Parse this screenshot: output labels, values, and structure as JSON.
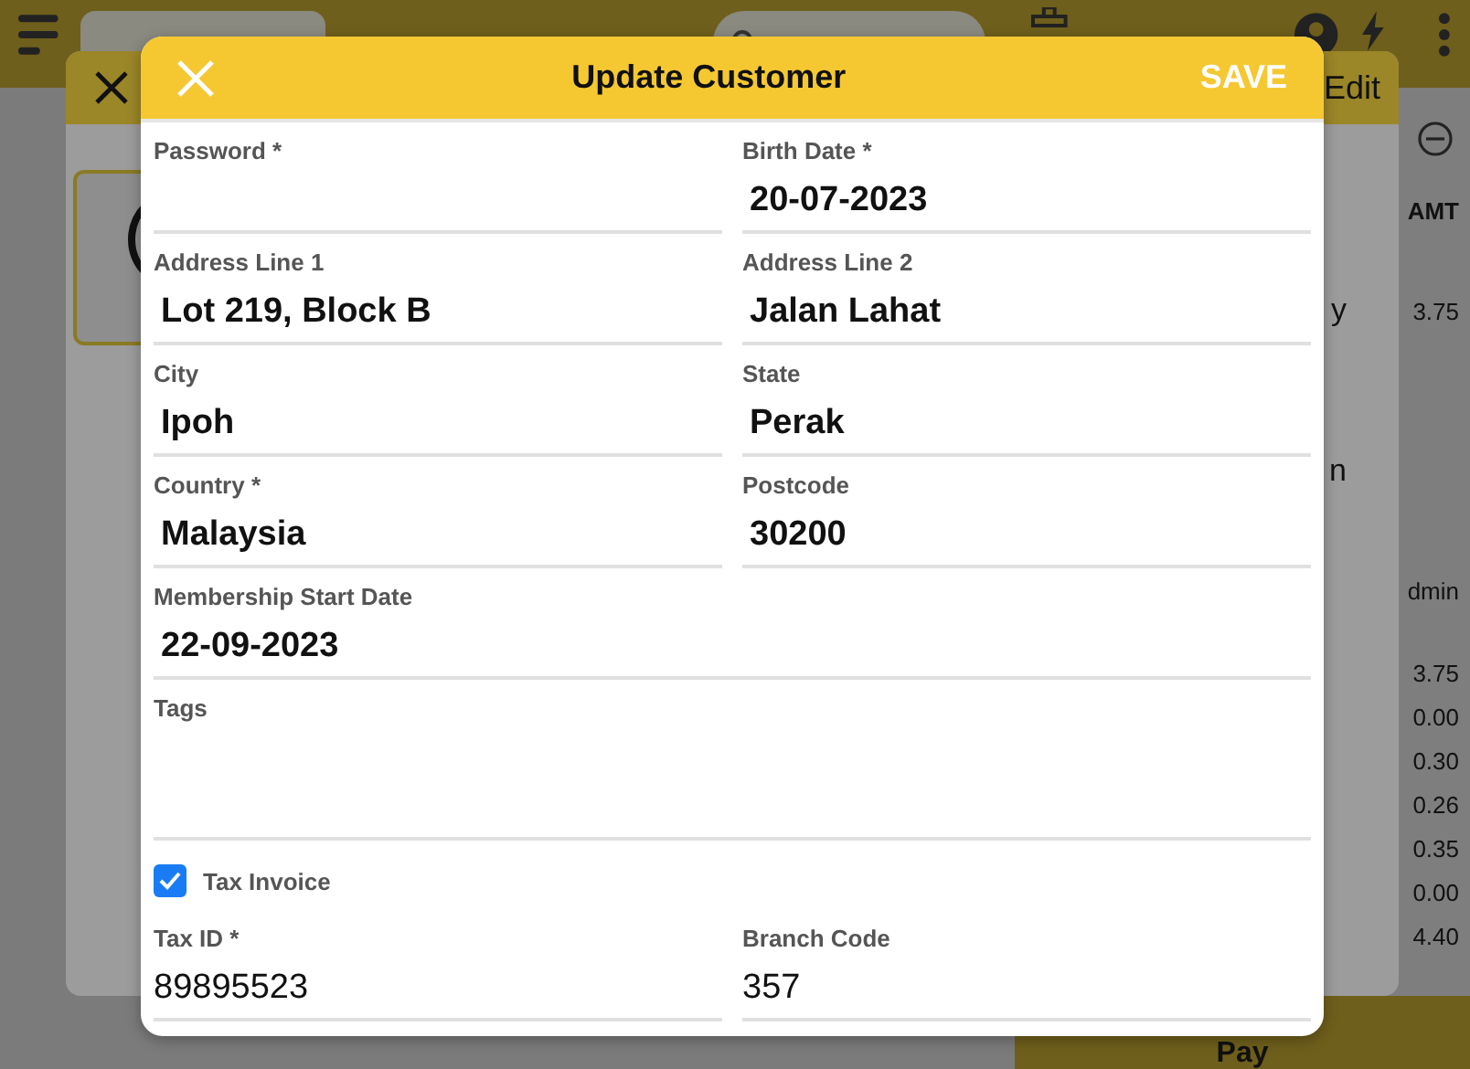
{
  "background": {
    "back_dialog": {
      "header_text": "Edit",
      "row_fragments": [
        "y",
        "n"
      ]
    },
    "order_panel": {
      "amount_header": "AMT",
      "first_amount": "3.75",
      "second_header": "dmin",
      "amounts": [
        "3.75",
        "0.00",
        "0.30",
        "0.26",
        "0.35",
        "0.00",
        "4.40"
      ]
    },
    "pay_button": "Pay"
  },
  "dialog": {
    "title": "Update Customer",
    "save": "SAVE",
    "fields": [
      {
        "label": "Password *",
        "kind": "half"
      },
      {
        "label": "Birth Date *",
        "value": "20-07-2023",
        "kind": "half"
      },
      {
        "label": "Address Line 1",
        "value": "Lot 219, Block B",
        "kind": "half"
      },
      {
        "label": "Address Line 2",
        "value": "Jalan Lahat",
        "kind": "half"
      },
      {
        "label": "City",
        "value": "Ipoh",
        "kind": "half"
      },
      {
        "label": "State",
        "value": "Perak",
        "kind": "half"
      },
      {
        "label": "Country *",
        "value": "Malaysia",
        "kind": "half"
      },
      {
        "label": "Postcode",
        "value": "30200",
        "kind": "half"
      },
      {
        "label": "Membership Start Date",
        "value": "22-09-2023",
        "kind": "full"
      },
      {
        "label": "Tags",
        "kind": "area"
      }
    ],
    "tax_invoice": {
      "label": "Tax Invoice",
      "checked": true
    },
    "tax_fields": [
      {
        "label": "Tax ID *",
        "value": "89895523"
      },
      {
        "label": "Branch Code",
        "value": "357"
      }
    ]
  }
}
